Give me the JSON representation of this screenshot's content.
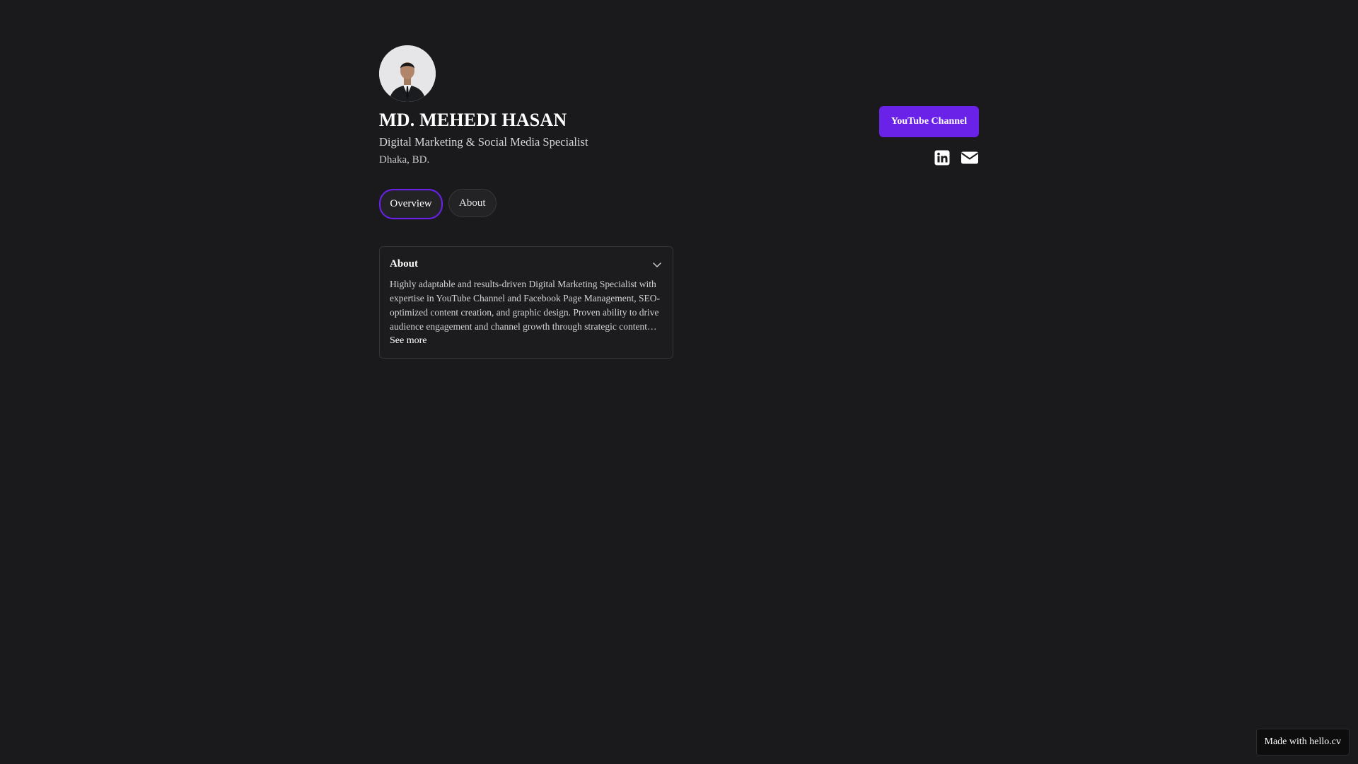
{
  "profile": {
    "name": "MD. MEHEDI HASAN",
    "headline": "Digital Marketing & Social Media Specialist",
    "location": "Dhaka, BD."
  },
  "actions": {
    "youtube_label": "YouTube Channel",
    "linkedin_icon": "linkedin-icon",
    "email_icon": "envelope-icon"
  },
  "tabs": [
    {
      "label": "Overview",
      "active": true
    },
    {
      "label": "About",
      "active": false
    }
  ],
  "about_card": {
    "title": "About",
    "body": "Highly adaptable and results-driven Digital Marketing Specialist with expertise in YouTube Channel and Facebook Page Management, SEO-optimized content creation, and graphic design. Proven ability to drive audience engagement and channel growth through strategic content planning and data-driven optimization.",
    "see_more": "See more"
  },
  "footer": {
    "badge": "Made with hello.cv"
  },
  "colors": {
    "background": "#1a191b",
    "accent": "#6a22e8"
  }
}
